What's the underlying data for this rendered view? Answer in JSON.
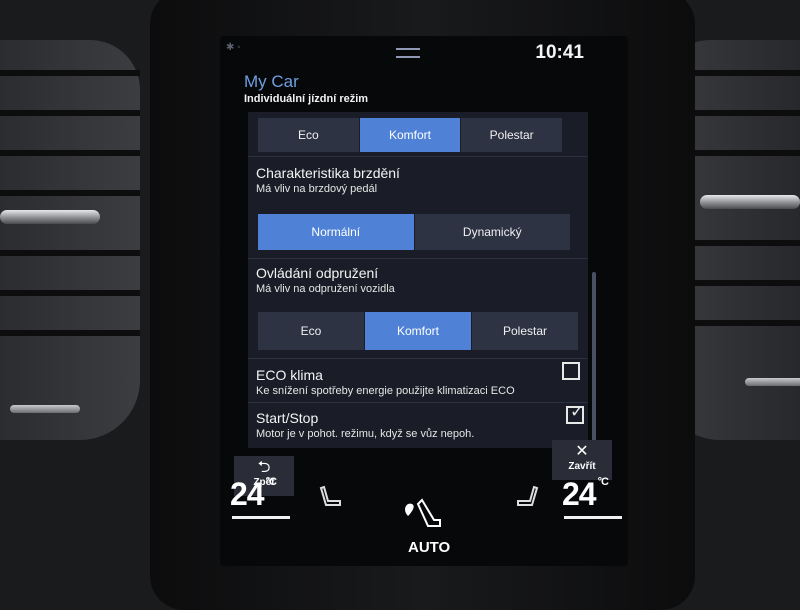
{
  "status": {
    "icons": "✱ ◦",
    "time": "10:41"
  },
  "header": {
    "app_title": "My Car",
    "subtitle": "Individuální jízdní režim"
  },
  "mode_selector_top": {
    "options": [
      "Eco",
      "Komfort",
      "Polestar"
    ],
    "selected": "Komfort"
  },
  "brake": {
    "title": "Charakteristika brzdění",
    "desc": "Má vliv na brzdový pedál",
    "options": [
      "Normální",
      "Dynamický"
    ],
    "selected": "Normální"
  },
  "suspension": {
    "title": "Ovládání odpružení",
    "desc": "Má vliv na odpružení vozidla",
    "options": [
      "Eco",
      "Komfort",
      "Polestar"
    ],
    "selected": "Komfort"
  },
  "eco_climate": {
    "title": "ECO klima",
    "desc": "Ke snížení spotřeby energie použijte klimatizaci ECO",
    "checked": false
  },
  "start_stop": {
    "title": "Start/Stop",
    "desc": "Motor je v pohot. režimu, když se vůz nepoh.",
    "checked": true
  },
  "footer": {
    "back_icon": "⮌",
    "back_label": "Zpět",
    "close_icon": "✕",
    "close_label": "Zavřít"
  },
  "climate": {
    "left_temp": "24",
    "right_temp": "24",
    "unit": "°C",
    "fan_label": "AUTO",
    "icons": {
      "left_seat": "seat-heater-icon",
      "right_seat": "seat-heater-icon",
      "fan": "fan-icon"
    }
  },
  "colors": {
    "accent": "#4f82d6",
    "panel": "#1a1d27",
    "segment": "#2e3344",
    "title": "#6f9fe0"
  }
}
